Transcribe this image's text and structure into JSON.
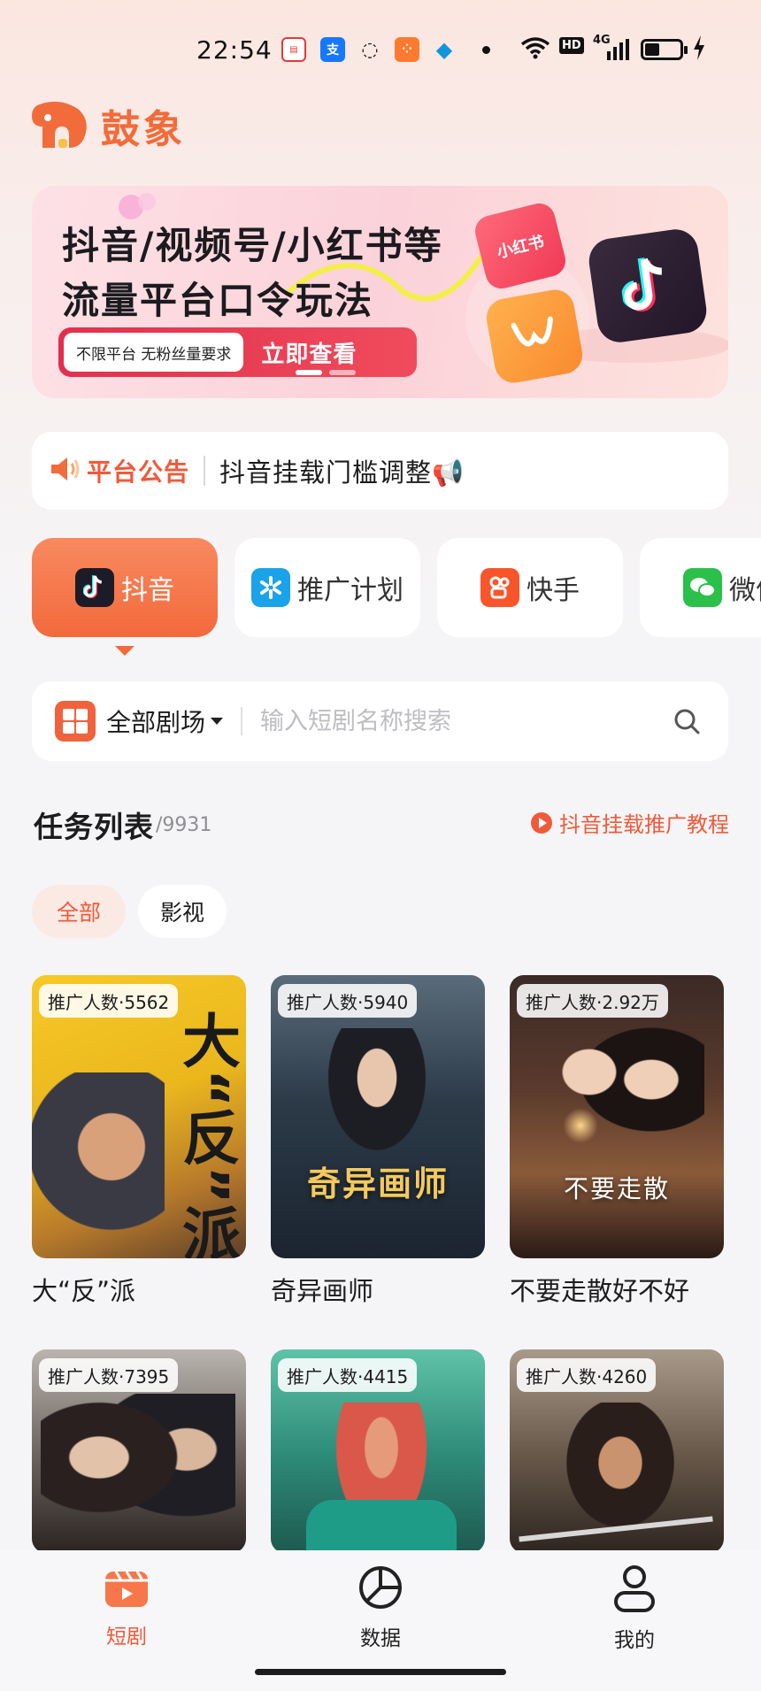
{
  "status_bar": {
    "time": "22:54",
    "network": "4G",
    "hd": "HD",
    "app_icons": [
      "red-app-icon",
      "alipay-icon",
      "message-icon",
      "kuaishou-icon",
      "qq-icon"
    ]
  },
  "brand": {
    "name": "鼓象",
    "color": "#f26b3a"
  },
  "banner": {
    "line1": "抖音/视频号/小红书等",
    "line2": "流量平台口令玩法",
    "tag": "不限平台 无粉丝量要求",
    "cta": "立即查看",
    "badge_xhs": "小红书"
  },
  "notice": {
    "title": "平台公告",
    "text": "抖音挂载门槛调整📢"
  },
  "platform_tabs": [
    {
      "label": "抖音",
      "icon": "douyin-icon",
      "active": true
    },
    {
      "label": "推广计划",
      "icon": "promo-plan-icon",
      "active": false
    },
    {
      "label": "快手",
      "icon": "kuaishou-icon",
      "active": false
    },
    {
      "label": "微信",
      "icon": "wechat-icon",
      "active": false
    }
  ],
  "search": {
    "theater_label": "全部剧场",
    "placeholder": "输入短剧名称搜索"
  },
  "task_list": {
    "title": "任务列表",
    "count": "/9931",
    "tutorial": "抖音挂载推广教程"
  },
  "filters": [
    {
      "label": "全部",
      "active": true
    },
    {
      "label": "影视",
      "active": false
    }
  ],
  "dramas": [
    {
      "title": "大“反”派",
      "promoters": "推广人数·5562",
      "poster_text": "大“反”派"
    },
    {
      "title": "奇异画师",
      "promoters": "推广人数·5940",
      "poster_text": "奇异画师"
    },
    {
      "title": "不要走散好不好",
      "promoters": "推广人数·2.92万",
      "poster_text": "不要走散"
    },
    {
      "title": "",
      "promoters": "推广人数·7395",
      "poster_text": ""
    },
    {
      "title": "",
      "promoters": "推广人数·4415",
      "poster_text": ""
    },
    {
      "title": "",
      "promoters": "推广人数·4260",
      "poster_text": ""
    }
  ],
  "bottom_nav": [
    {
      "label": "短剧",
      "icon": "short-drama-icon",
      "active": true
    },
    {
      "label": "数据",
      "icon": "data-chart-icon",
      "active": false
    },
    {
      "label": "我的",
      "icon": "profile-icon",
      "active": false
    }
  ]
}
